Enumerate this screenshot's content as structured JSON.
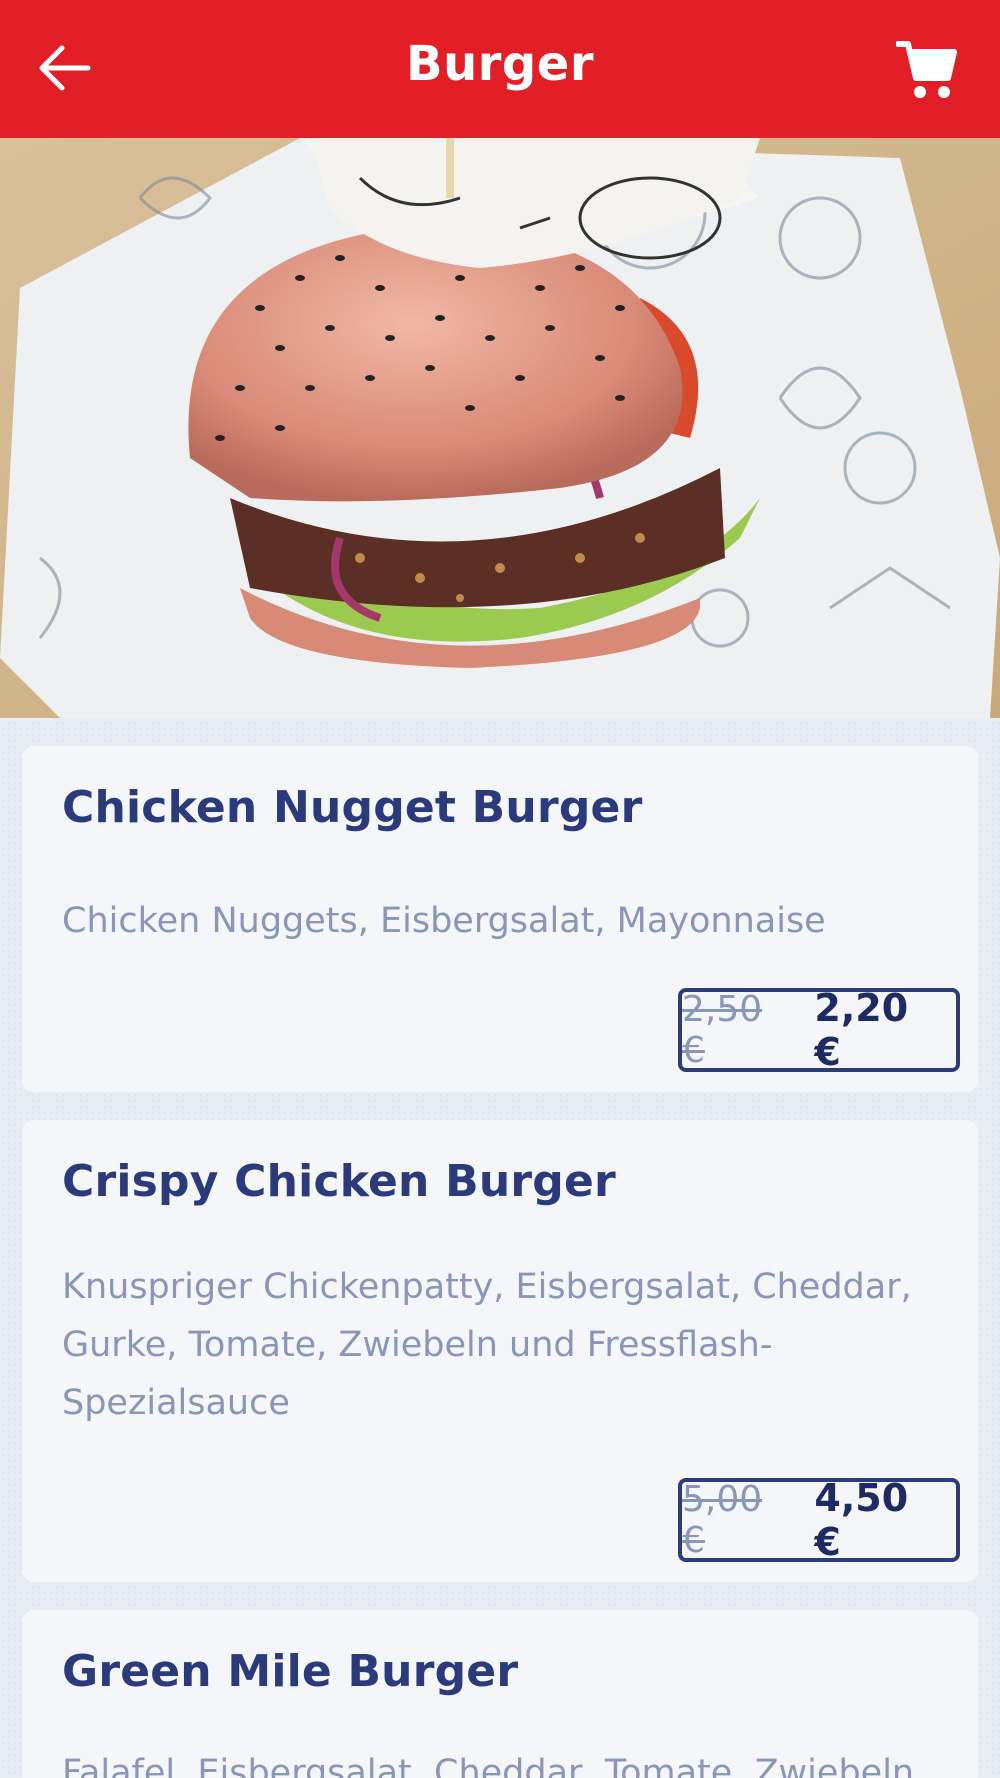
{
  "header": {
    "title": "Burger",
    "back_icon": "arrow-left-icon",
    "cart_icon": "shopping-cart-icon",
    "background_color": "#e21f26"
  },
  "hero": {
    "image": "burger-photo"
  },
  "products": [
    {
      "name": "Chicken Nugget Burger",
      "description": "Chicken Nuggets, Eisbergsalat, Mayonnaise",
      "old_price": "2,50 €",
      "price": "2,20 €"
    },
    {
      "name": "Crispy Chicken Burger",
      "description_lines": [
        "Knuspriger Chickenpatty, Eisbergsalat, Cheddar,",
        "Gurke, Tomate, Zwiebeln und Fressflash-",
        "Spezialsauce"
      ],
      "old_price": "5,00 €",
      "price": "4,50 €"
    },
    {
      "name": "Green Mile Burger",
      "description": "Falafel, Eisbergsalat, Cheddar, Tomate, Zwiebeln"
    }
  ],
  "colors": {
    "accent": "#e21f26",
    "title_text": "#2a3a7a",
    "muted_text": "#8a96b8",
    "card_bg": "#f4f6f9"
  }
}
